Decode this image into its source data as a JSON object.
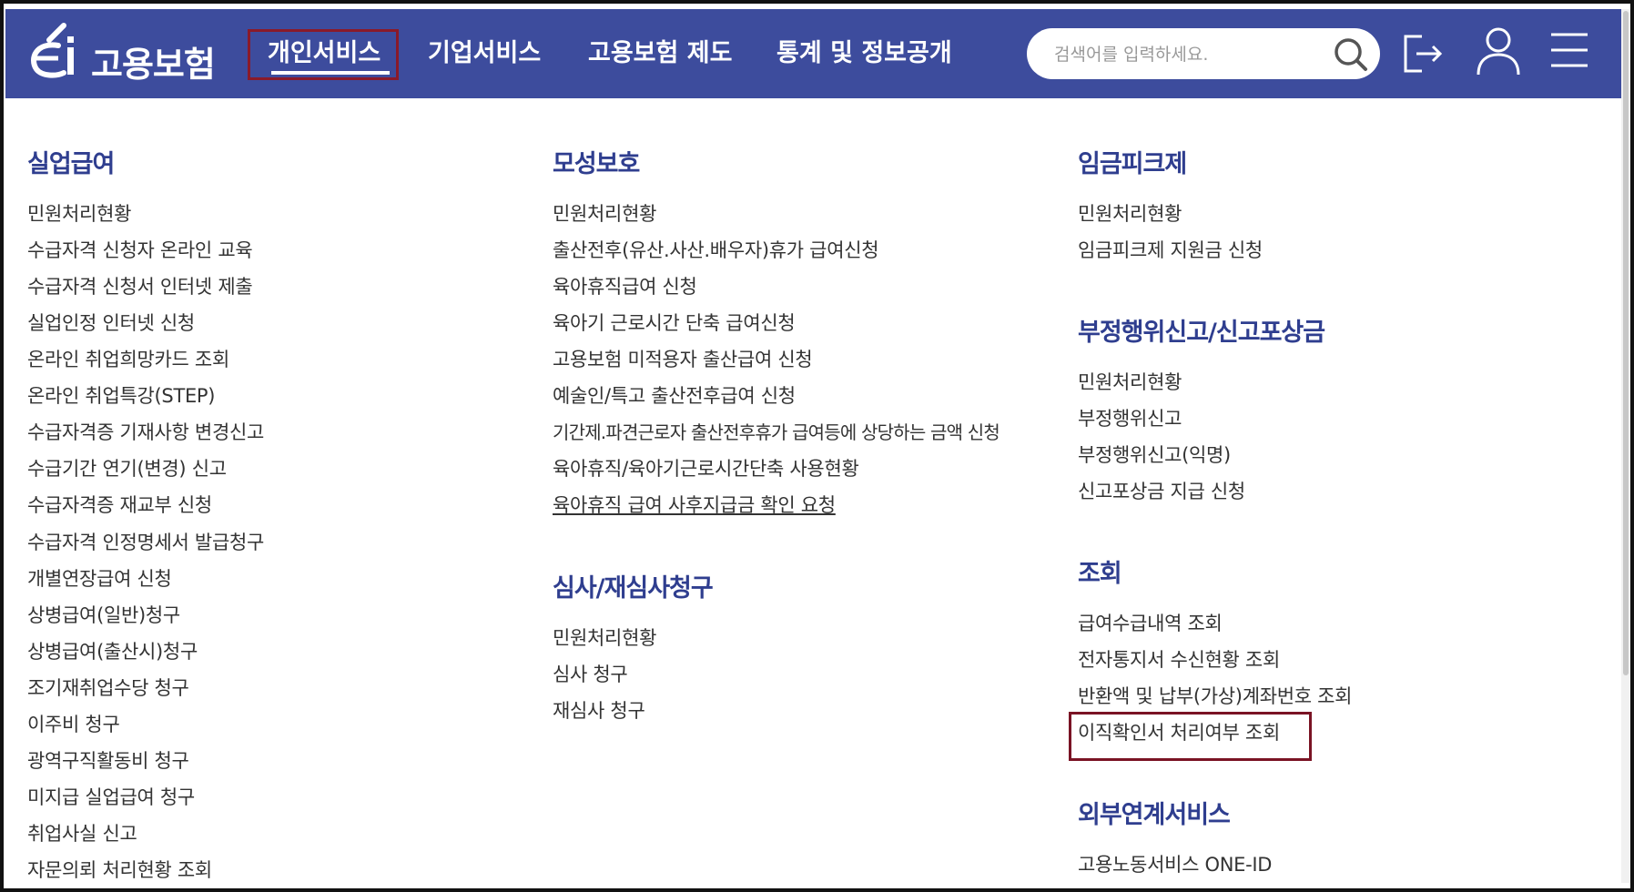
{
  "header": {
    "logo_text": "고용보험",
    "nav": [
      "개인서비스",
      "기업서비스",
      "고용보험 제도",
      "통계 및 정보공개"
    ],
    "search_placeholder": "검색어를 입력하세요."
  },
  "columns": [
    {
      "sections": [
        {
          "title": "실업급여",
          "items": [
            "민원처리현황",
            "수급자격 신청자 온라인 교육",
            "수급자격 신청서 인터넷 제출",
            "실업인정 인터넷 신청",
            "온라인 취업희망카드 조회",
            "온라인 취업특강(STEP)",
            "수급자격증 기재사항 변경신고",
            "수급기간 연기(변경) 신고",
            "수급자격증 재교부 신청",
            "수급자격 인정명세서 발급청구",
            "개별연장급여 신청",
            "상병급여(일반)청구",
            "상병급여(출산시)청구",
            "조기재취업수당 청구",
            "이주비 청구",
            "광역구직활동비 청구",
            "미지급 실업급여 청구",
            "취업사실 신고",
            "자문의뢰 처리현황 조회"
          ]
        }
      ]
    },
    {
      "sections": [
        {
          "title": "모성보호",
          "items": [
            "민원처리현황",
            "출산전후(유산.사산.배우자)휴가 급여신청",
            "육아휴직급여 신청",
            "육아기 근로시간 단축 급여신청",
            "고용보험 미적용자 출산급여 신청",
            "예술인/특고 출산전후급여 신청",
            "기간제.파견근로자 출산전후휴가 급여등에 상당하는 금액 신청",
            "육아휴직/육아기근로시간단축 사용현황",
            "육아휴직 급여 사후지급금 확인 요청"
          ]
        },
        {
          "title": "심사/재심사청구",
          "items": [
            "민원처리현황",
            "심사 청구",
            "재심사 청구"
          ]
        }
      ]
    },
    {
      "sections": [
        {
          "title": "임금피크제",
          "items": [
            "민원처리현황",
            "임금피크제 지원금 신청"
          ]
        },
        {
          "title": "부정행위신고/신고포상금",
          "items": [
            "민원처리현황",
            "부정행위신고",
            "부정행위신고(익명)",
            "신고포상금 지급 신청"
          ]
        },
        {
          "title": "조회",
          "items": [
            "급여수급내역 조회",
            "전자통지서 수신현황 조회",
            "반환액 및 납부(가상)계좌번호 조회",
            "이직확인서 처리여부 조회"
          ]
        },
        {
          "title": "외부연계서비스",
          "items": [
            "고용노동서비스 ONE-ID"
          ]
        }
      ]
    }
  ]
}
